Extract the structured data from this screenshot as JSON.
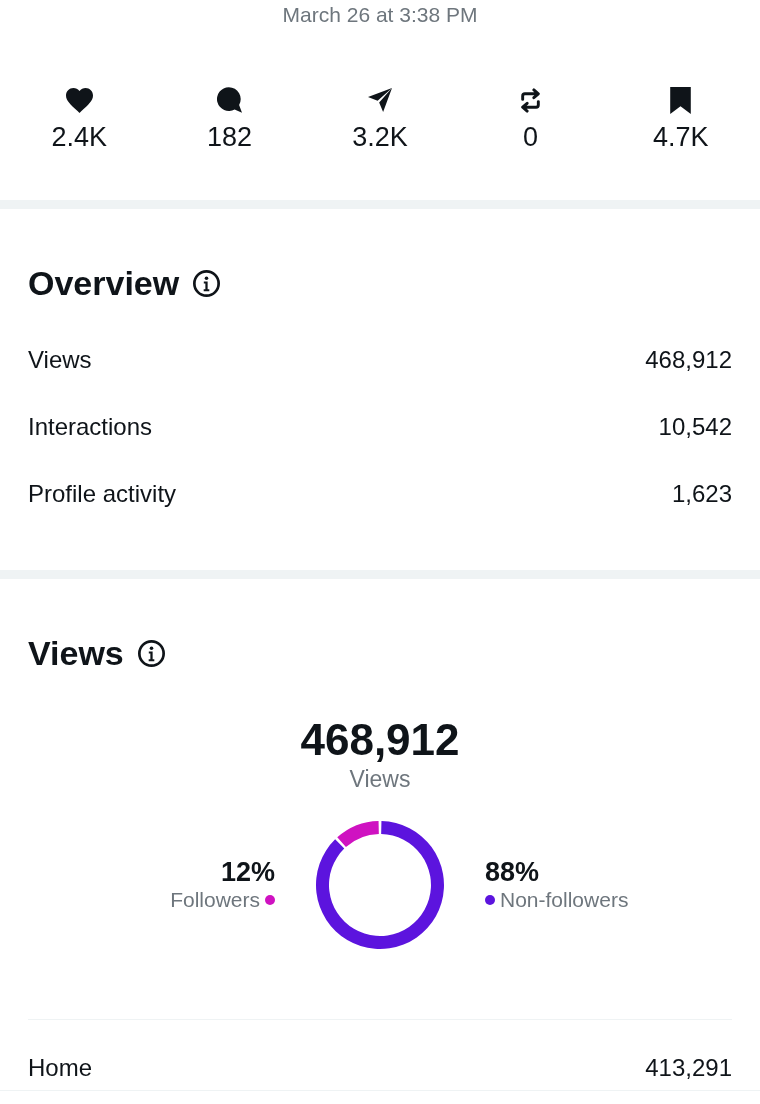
{
  "post": {
    "timestamp": "March 26 at 3:38 PM"
  },
  "engagement": [
    {
      "value": "2.4K"
    },
    {
      "value": "182"
    },
    {
      "value": "3.2K"
    },
    {
      "value": "0"
    },
    {
      "value": "4.7K"
    }
  ],
  "overview": {
    "title": "Overview",
    "rows": [
      {
        "label": "Views",
        "value": "468,912"
      },
      {
        "label": "Interactions",
        "value": "10,542"
      },
      {
        "label": "Profile activity",
        "value": "1,623"
      }
    ]
  },
  "views": {
    "title": "Views",
    "total": "468,912",
    "total_label": "Views",
    "legend": [
      {
        "percent": "12%",
        "color": "#cf12c1"
      },
      {
        "percent": "88%",
        "color": "#5c14de"
      }
    ],
    "chart_data": {
      "type": "donut",
      "categories": [
        "Followers",
        "Non-followers"
      ],
      "values": [
        12,
        88
      ]
    },
    "sources": [
      {
        "label": "Home",
        "value": "413,291"
      }
    ]
  }
}
